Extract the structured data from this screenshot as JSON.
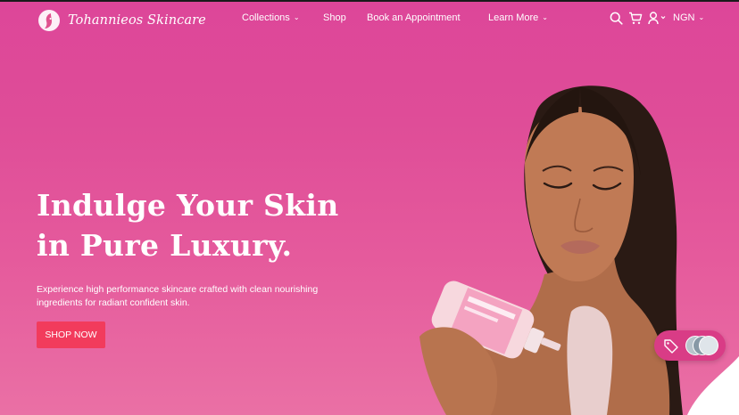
{
  "brand": {
    "name": "Tohannieos Skincare",
    "logo_icon": "face-logo-icon"
  },
  "nav": {
    "items": [
      {
        "label": "Collections",
        "has_dropdown": true
      },
      {
        "label": "Shop",
        "has_dropdown": false
      },
      {
        "label": "Book an Appointment",
        "has_dropdown": false
      },
      {
        "label": "Learn More",
        "has_dropdown": true
      }
    ]
  },
  "header_actions": {
    "icons": [
      "search-icon",
      "cart-icon",
      "account-icon"
    ],
    "currency": "NGN"
  },
  "hero": {
    "heading_line1": "Indulge Your Skin",
    "heading_line2": "in Pure Luxury.",
    "description": "Experience high performance skincare crafted with clean nourishing ingredients for radiant confident skin.",
    "cta_label": "SHOP NOW"
  },
  "floating_widget": {
    "icons": [
      "tag-icon",
      "avatar-group"
    ]
  },
  "colors": {
    "background_top": "#dd4699",
    "background_bottom": "#ea70a5",
    "cta": "#f23b5c",
    "text": "#ffffff"
  }
}
